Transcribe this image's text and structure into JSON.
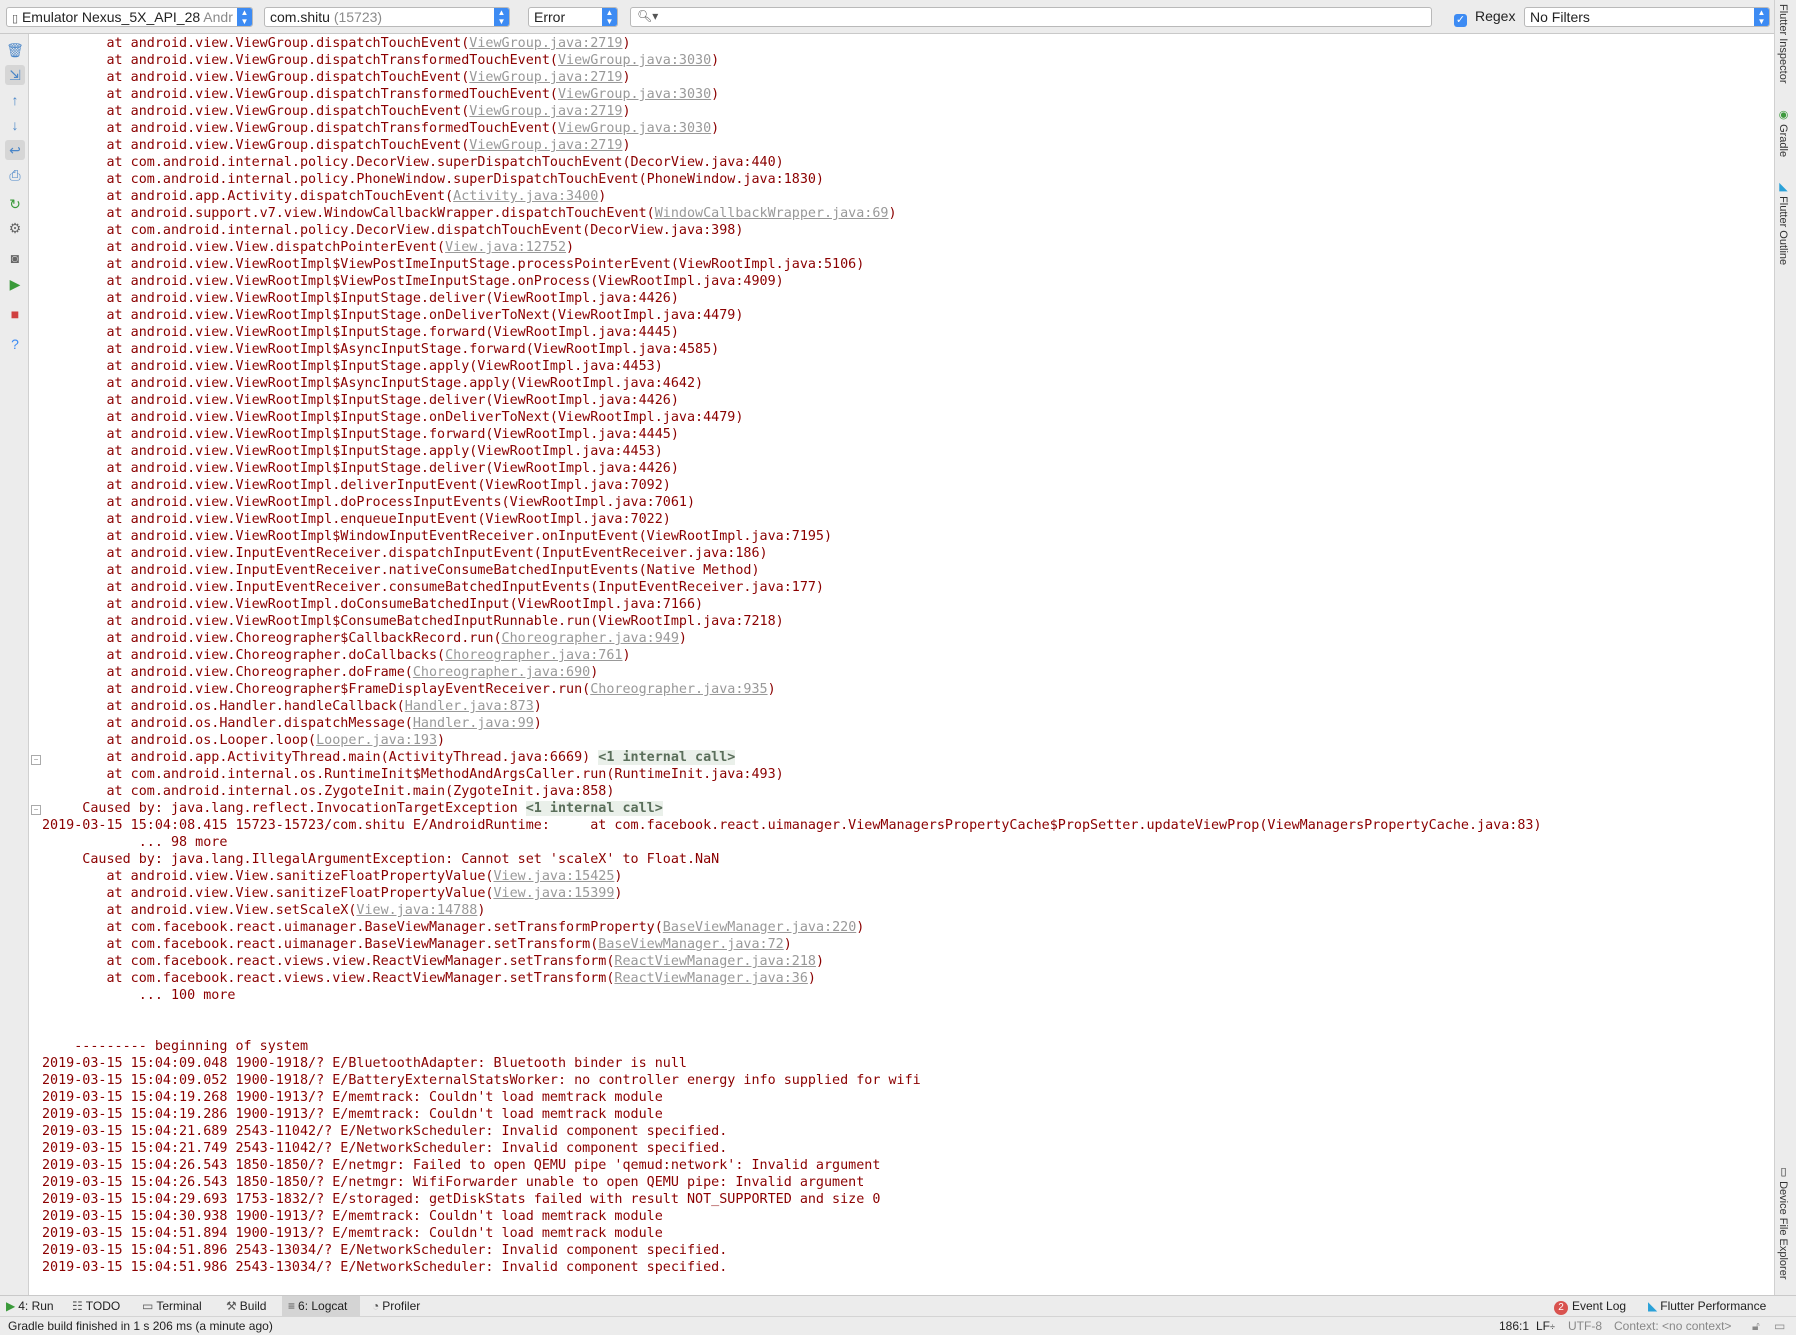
{
  "toolbar": {
    "device_name": "Emulator Nexus_5X_API_28",
    "device_os": "Andr",
    "process_name": "com.shitu",
    "process_pid": "(15723)",
    "log_level": "Error",
    "search_value": "",
    "regex_label": "Regex",
    "regex_checked": true,
    "filter_label": "No Filters"
  },
  "right_tools": {
    "flutter_inspector": "Flutter Inspector",
    "gradle": "Gradle",
    "flutter_outline": "Flutter Outline",
    "device_file_explorer": "Device File Explorer"
  },
  "log": {
    "lines": [
      [
        {
          "t": "        at android.view.ViewGroup.dispatchTouchEvent("
        },
        {
          "t": "ViewGroup.java:2719",
          "k": "link"
        },
        {
          "t": ")"
        }
      ],
      [
        {
          "t": "        at android.view.ViewGroup.dispatchTransformedTouchEvent("
        },
        {
          "t": "ViewGroup.java:3030",
          "k": "link"
        },
        {
          "t": ")"
        }
      ],
      [
        {
          "t": "        at android.view.ViewGroup.dispatchTouchEvent("
        },
        {
          "t": "ViewGroup.java:2719",
          "k": "link"
        },
        {
          "t": ")"
        }
      ],
      [
        {
          "t": "        at android.view.ViewGroup.dispatchTransformedTouchEvent("
        },
        {
          "t": "ViewGroup.java:3030",
          "k": "link"
        },
        {
          "t": ")"
        }
      ],
      [
        {
          "t": "        at android.view.ViewGroup.dispatchTouchEvent("
        },
        {
          "t": "ViewGroup.java:2719",
          "k": "link"
        },
        {
          "t": ")"
        }
      ],
      [
        {
          "t": "        at android.view.ViewGroup.dispatchTransformedTouchEvent("
        },
        {
          "t": "ViewGroup.java:3030",
          "k": "link"
        },
        {
          "t": ")"
        }
      ],
      [
        {
          "t": "        at android.view.ViewGroup.dispatchTouchEvent("
        },
        {
          "t": "ViewGroup.java:2719",
          "k": "link"
        },
        {
          "t": ")"
        }
      ],
      [
        {
          "t": "        at com.android.internal.policy.DecorView.superDispatchTouchEvent(DecorView.java:440)"
        }
      ],
      [
        {
          "t": "        at com.android.internal.policy.PhoneWindow.superDispatchTouchEvent(PhoneWindow.java:1830)"
        }
      ],
      [
        {
          "t": "        at android.app.Activity.dispatchTouchEvent("
        },
        {
          "t": "Activity.java:3400",
          "k": "link"
        },
        {
          "t": ")"
        }
      ],
      [
        {
          "t": "        at android.support.v7.view.WindowCallbackWrapper.dispatchTouchEvent("
        },
        {
          "t": "WindowCallbackWrapper.java:69",
          "k": "link"
        },
        {
          "t": ")"
        }
      ],
      [
        {
          "t": "        at com.android.internal.policy.DecorView.dispatchTouchEvent(DecorView.java:398)"
        }
      ],
      [
        {
          "t": "        at android.view.View.dispatchPointerEvent("
        },
        {
          "t": "View.java:12752",
          "k": "link"
        },
        {
          "t": ")"
        }
      ],
      [
        {
          "t": "        at android.view.ViewRootImpl$ViewPostImeInputStage.processPointerEvent(ViewRootImpl.java:5106)"
        }
      ],
      [
        {
          "t": "        at android.view.ViewRootImpl$ViewPostImeInputStage.onProcess(ViewRootImpl.java:4909)"
        }
      ],
      [
        {
          "t": "        at android.view.ViewRootImpl$InputStage.deliver(ViewRootImpl.java:4426)"
        }
      ],
      [
        {
          "t": "        at android.view.ViewRootImpl$InputStage.onDeliverToNext(ViewRootImpl.java:4479)"
        }
      ],
      [
        {
          "t": "        at android.view.ViewRootImpl$InputStage.forward(ViewRootImpl.java:4445)"
        }
      ],
      [
        {
          "t": "        at android.view.ViewRootImpl$AsyncInputStage.forward(ViewRootImpl.java:4585)"
        }
      ],
      [
        {
          "t": "        at android.view.ViewRootImpl$InputStage.apply(ViewRootImpl.java:4453)"
        }
      ],
      [
        {
          "t": "        at android.view.ViewRootImpl$AsyncInputStage.apply(ViewRootImpl.java:4642)"
        }
      ],
      [
        {
          "t": "        at android.view.ViewRootImpl$InputStage.deliver(ViewRootImpl.java:4426)"
        }
      ],
      [
        {
          "t": "        at android.view.ViewRootImpl$InputStage.onDeliverToNext(ViewRootImpl.java:4479)"
        }
      ],
      [
        {
          "t": "        at android.view.ViewRootImpl$InputStage.forward(ViewRootImpl.java:4445)"
        }
      ],
      [
        {
          "t": "        at android.view.ViewRootImpl$InputStage.apply(ViewRootImpl.java:4453)"
        }
      ],
      [
        {
          "t": "        at android.view.ViewRootImpl$InputStage.deliver(ViewRootImpl.java:4426)"
        }
      ],
      [
        {
          "t": "        at android.view.ViewRootImpl.deliverInputEvent(ViewRootImpl.java:7092)"
        }
      ],
      [
        {
          "t": "        at android.view.ViewRootImpl.doProcessInputEvents(ViewRootImpl.java:7061)"
        }
      ],
      [
        {
          "t": "        at android.view.ViewRootImpl.enqueueInputEvent(ViewRootImpl.java:7022)"
        }
      ],
      [
        {
          "t": "        at android.view.ViewRootImpl$WindowInputEventReceiver.onInputEvent(ViewRootImpl.java:7195)"
        }
      ],
      [
        {
          "t": "        at android.view.InputEventReceiver.dispatchInputEvent(InputEventReceiver.java:186)"
        }
      ],
      [
        {
          "t": "        at android.view.InputEventReceiver.nativeConsumeBatchedInputEvents(Native Method)"
        }
      ],
      [
        {
          "t": "        at android.view.InputEventReceiver.consumeBatchedInputEvents(InputEventReceiver.java:177)"
        }
      ],
      [
        {
          "t": "        at android.view.ViewRootImpl.doConsumeBatchedInput(ViewRootImpl.java:7166)"
        }
      ],
      [
        {
          "t": "        at android.view.ViewRootImpl$ConsumeBatchedInputRunnable.run(ViewRootImpl.java:7218)"
        }
      ],
      [
        {
          "t": "        at android.view.Choreographer$CallbackRecord.run("
        },
        {
          "t": "Choreographer.java:949",
          "k": "link"
        },
        {
          "t": ")"
        }
      ],
      [
        {
          "t": "        at android.view.Choreographer.doCallbacks("
        },
        {
          "t": "Choreographer.java:761",
          "k": "link"
        },
        {
          "t": ")"
        }
      ],
      [
        {
          "t": "        at android.view.Choreographer.doFrame("
        },
        {
          "t": "Choreographer.java:690",
          "k": "link"
        },
        {
          "t": ")"
        }
      ],
      [
        {
          "t": "        at android.view.Choreographer$FrameDisplayEventReceiver.run("
        },
        {
          "t": "Choreographer.java:935",
          "k": "link"
        },
        {
          "t": ")"
        }
      ],
      [
        {
          "t": "        at android.os.Handler.handleCallback("
        },
        {
          "t": "Handler.java:873",
          "k": "link"
        },
        {
          "t": ")"
        }
      ],
      [
        {
          "t": "        at android.os.Handler.dispatchMessage("
        },
        {
          "t": "Handler.java:99",
          "k": "link"
        },
        {
          "t": ")"
        }
      ],
      [
        {
          "t": "        at android.os.Looper.loop("
        },
        {
          "t": "Looper.java:193",
          "k": "link"
        },
        {
          "t": ")"
        }
      ],
      [
        {
          "t": "        at android.app.ActivityThread.main(ActivityThread.java:6669) "
        },
        {
          "t": "<1 internal call>",
          "k": "tag"
        }
      ],
      [
        {
          "t": "        at com.android.internal.os.RuntimeInit$MethodAndArgsCaller.run(RuntimeInit.java:493)"
        }
      ],
      [
        {
          "t": "        at com.android.internal.os.ZygoteInit.main(ZygoteInit.java:858)"
        }
      ],
      [
        {
          "t": "     Caused by: java.lang.reflect.InvocationTargetException "
        },
        {
          "t": "<1 internal call>",
          "k": "tag"
        }
      ],
      [
        {
          "t": "2019-03-15 15:04:08.415 15723-15723/com.shitu E/AndroidRuntime:     at com.facebook.react.uimanager.ViewManagersPropertyCache$PropSetter.updateViewProp(ViewManagersPropertyCache.java:83)"
        }
      ],
      [
        {
          "t": "            ... 98 more"
        }
      ],
      [
        {
          "t": "     Caused by: java.lang.IllegalArgumentException: Cannot set 'scaleX' to Float.NaN"
        }
      ],
      [
        {
          "t": "        at android.view.View.sanitizeFloatPropertyValue("
        },
        {
          "t": "View.java:15425",
          "k": "link"
        },
        {
          "t": ")"
        }
      ],
      [
        {
          "t": "        at android.view.View.sanitizeFloatPropertyValue("
        },
        {
          "t": "View.java:15399",
          "k": "link"
        },
        {
          "t": ")"
        }
      ],
      [
        {
          "t": "        at android.view.View.setScaleX("
        },
        {
          "t": "View.java:14788",
          "k": "link"
        },
        {
          "t": ")"
        }
      ],
      [
        {
          "t": "        at com.facebook.react.uimanager.BaseViewManager.setTransformProperty("
        },
        {
          "t": "BaseViewManager.java:220",
          "k": "link"
        },
        {
          "t": ")"
        }
      ],
      [
        {
          "t": "        at com.facebook.react.uimanager.BaseViewManager.setTransform("
        },
        {
          "t": "BaseViewManager.java:72",
          "k": "link"
        },
        {
          "t": ")"
        }
      ],
      [
        {
          "t": "        at com.facebook.react.views.view.ReactViewManager.setTransform("
        },
        {
          "t": "ReactViewManager.java:218",
          "k": "link"
        },
        {
          "t": ")"
        }
      ],
      [
        {
          "t": "        at com.facebook.react.views.view.ReactViewManager.setTransform("
        },
        {
          "t": "ReactViewManager.java:36",
          "k": "link"
        },
        {
          "t": ")"
        }
      ],
      [
        {
          "t": "            ... 100 more"
        }
      ],
      [
        {
          "t": ""
        }
      ],
      [
        {
          "t": ""
        }
      ],
      [
        {
          "t": "    --------- beginning of system"
        }
      ],
      [
        {
          "t": "2019-03-15 15:04:09.048 1900-1918/? E/BluetoothAdapter: Bluetooth binder is null"
        }
      ],
      [
        {
          "t": "2019-03-15 15:04:09.052 1900-1918/? E/BatteryExternalStatsWorker: no controller energy info supplied for wifi"
        }
      ],
      [
        {
          "t": "2019-03-15 15:04:19.268 1900-1913/? E/memtrack: Couldn't load memtrack module"
        }
      ],
      [
        {
          "t": "2019-03-15 15:04:19.286 1900-1913/? E/memtrack: Couldn't load memtrack module"
        }
      ],
      [
        {
          "t": "2019-03-15 15:04:21.689 2543-11042/? E/NetworkScheduler: Invalid component specified."
        }
      ],
      [
        {
          "t": "2019-03-15 15:04:21.749 2543-11042/? E/NetworkScheduler: Invalid component specified."
        }
      ],
      [
        {
          "t": "2019-03-15 15:04:26.543 1850-1850/? E/netmgr: Failed to open QEMU pipe 'qemud:network': Invalid argument"
        }
      ],
      [
        {
          "t": "2019-03-15 15:04:26.543 1850-1850/? E/netmgr: WifiForwarder unable to open QEMU pipe: Invalid argument"
        }
      ],
      [
        {
          "t": "2019-03-15 15:04:29.693 1753-1832/? E/storaged: getDiskStats failed with result NOT_SUPPORTED and size 0"
        }
      ],
      [
        {
          "t": "2019-03-15 15:04:30.938 1900-1913/? E/memtrack: Couldn't load memtrack module"
        }
      ],
      [
        {
          "t": "2019-03-15 15:04:51.894 1900-1913/? E/memtrack: Couldn't load memtrack module"
        }
      ],
      [
        {
          "t": "2019-03-15 15:04:51.896 2543-13034/? E/NetworkScheduler: Invalid component specified."
        }
      ],
      [
        {
          "t": "2019-03-15 15:04:51.986 2543-13034/? E/NetworkScheduler: Invalid component specified."
        }
      ]
    ]
  },
  "bottom_tabs": {
    "run": "4: Run",
    "todo": "TODO",
    "terminal": "Terminal",
    "build": "Build",
    "logcat": "6: Logcat",
    "profiler": "Profiler",
    "event_log": "Event Log",
    "event_log_count": "2",
    "flutter_performance": "Flutter Performance"
  },
  "status": {
    "message": "Gradle build finished in 1 s 206 ms (a minute ago)",
    "position": "186:1",
    "line_sep": "LF",
    "encoding": "UTF-8",
    "context": "Context: <no context>"
  },
  "colors": {
    "log_error": "#8b0000",
    "accent": "#3d8bf3"
  }
}
